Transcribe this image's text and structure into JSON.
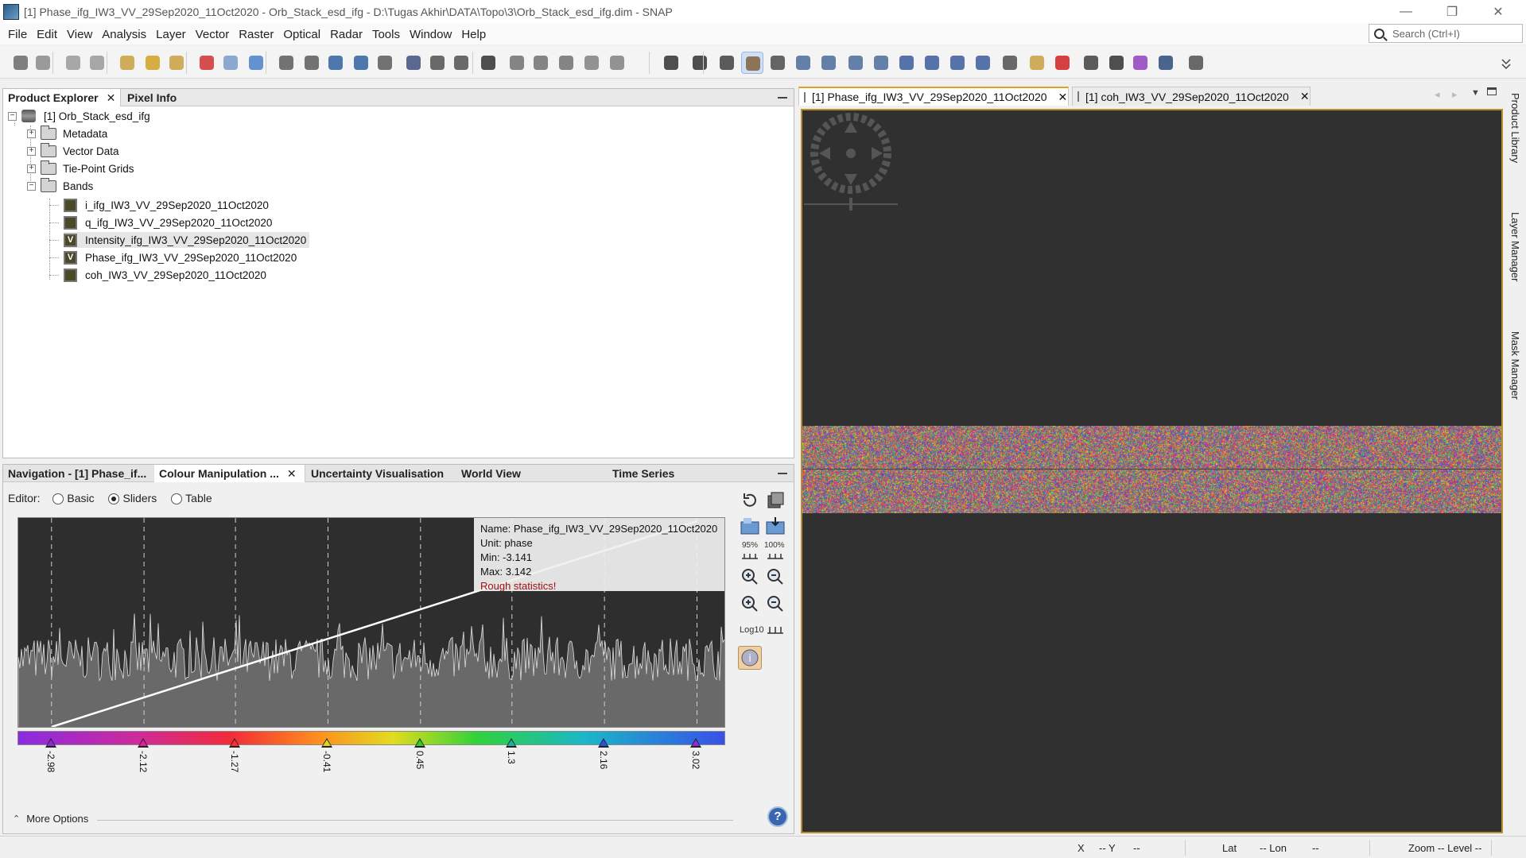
{
  "window": {
    "title": "[1] Phase_ifg_IW3_VV_29Sep2020_11Oct2020 - Orb_Stack_esd_ifg - D:\\Tugas Akhir\\DATA\\Topo\\3\\Orb_Stack_esd_ifg.dim - SNAP",
    "minimize": "—",
    "restore": "❐",
    "close": "✕"
  },
  "menu": [
    "File",
    "Edit",
    "View",
    "Analysis",
    "Layer",
    "Vector",
    "Raster",
    "Optical",
    "Radar",
    "Tools",
    "Window",
    "Help"
  ],
  "search": {
    "placeholder": "Search (Ctrl+I)"
  },
  "top_left_tabs": {
    "product_explorer": "Product Explorer",
    "pixel_info": "Pixel Info",
    "close": "✕"
  },
  "tree": {
    "root": "[1] Orb_Stack_esd_ifg",
    "folders": [
      "Metadata",
      "Vector Data",
      "Tie-Point Grids",
      "Bands"
    ],
    "bands": [
      "i_ifg_IW3_VV_29Sep2020_11Oct2020",
      "q_ifg_IW3_VV_29Sep2020_11Oct2020",
      "Intensity_ifg_IW3_VV_29Sep2020_11Oct2020",
      "Phase_ifg_IW3_VV_29Sep2020_11Oct2020",
      "coh_IW3_VV_29Sep2020_11Oct2020"
    ],
    "virtual_mark": "V",
    "expand_plus": "+",
    "expand_minus": "−"
  },
  "bottom_tabs": {
    "navigation": "Navigation - [1] Phase_if...",
    "colour": "Colour Manipulation ...",
    "uncertainty": "Uncertainty Visualisation",
    "world": "World View",
    "time": "Time Series",
    "close": "✕"
  },
  "editor": {
    "label": "Editor:",
    "options": [
      "Basic",
      "Sliders",
      "Table"
    ],
    "selected": "Sliders"
  },
  "stats": {
    "name": "Name: Phase_ifg_IW3_VV_29Sep2020_11Oct2020",
    "unit": "Unit: phase",
    "min": "Min: -3.141",
    "max": "Max: 3.142",
    "warning": "Rough statistics!"
  },
  "slider_values": [
    "-2.98",
    "-2.12",
    "-1.27",
    "-0.41",
    "0.45",
    "1.3",
    "2.16",
    "3.02"
  ],
  "slider_colors": [
    "#8a2be2",
    "#e0209a",
    "#ff3030",
    "#d8d820",
    "#30cc30",
    "#20b0a0",
    "#3050e0",
    "#8a2be2"
  ],
  "tools": {
    "pct95": "95%",
    "pct100": "100%",
    "log": "Log10"
  },
  "more_options": "More Options",
  "help_icon": "?",
  "image_tabs": [
    "[1] Phase_ifg_IW3_VV_29Sep2020_11Oct2020",
    "[1] coh_IW3_VV_29Sep2020_11Oct2020"
  ],
  "side_tabs": [
    "Product Library",
    "Layer Manager",
    "Mask Manager"
  ],
  "status": {
    "x": "X",
    "xval": "-- Y",
    "yval": "--",
    "lat": "Lat",
    "latval": "-- Lon",
    "lonval": "--",
    "zoom": "Zoom -- Level --"
  }
}
